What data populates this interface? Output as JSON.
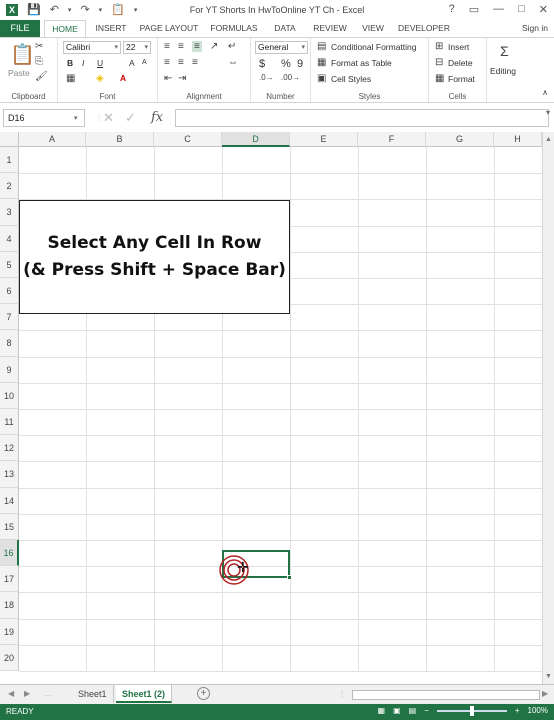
{
  "window": {
    "title": "For YT Shorts In HwToOnline YT Ch - Excel",
    "controls": [
      "?",
      "▭",
      "—",
      "□",
      "✕"
    ]
  },
  "tabs": {
    "file": "FILE",
    "items": [
      "HOME",
      "INSERT",
      "PAGE LAYOUT",
      "FORMULAS",
      "DATA",
      "REVIEW",
      "VIEW",
      "DEVELOPER"
    ],
    "active": "HOME",
    "signin": "Sign in"
  },
  "ribbon": {
    "clipboard": {
      "label": "Clipboard",
      "paste": "Paste"
    },
    "font": {
      "label": "Font",
      "name": "Calibri",
      "size": "22",
      "bold": "B",
      "italic": "I",
      "underline": "U",
      "grow": "A",
      "shrink": "A"
    },
    "alignment": {
      "label": "Alignment"
    },
    "number": {
      "label": "Number",
      "format": "General",
      "currency": "$",
      "percent": "%",
      "comma": "9"
    },
    "styles": {
      "label": "Styles",
      "conditional": "Conditional Formatting",
      "table": "Format as Table",
      "cell_styles": "Cell Styles"
    },
    "cells": {
      "label": "Cells",
      "insert": "Insert",
      "delete": "Delete",
      "format": "Format"
    },
    "editing": {
      "label": "Editing"
    }
  },
  "formula_bar": {
    "name_box": "D16",
    "fx": "fx",
    "value": ""
  },
  "grid": {
    "columns": [
      "A",
      "B",
      "C",
      "D",
      "E",
      "F",
      "G",
      "H"
    ],
    "rows": [
      "1",
      "2",
      "3",
      "4",
      "5",
      "6",
      "7",
      "8",
      "9",
      "10",
      "11",
      "12",
      "13",
      "14",
      "15",
      "16",
      "17",
      "18",
      "19",
      "20"
    ],
    "selected_col": "D",
    "selected_row": "16"
  },
  "textbox": {
    "line1": "Select Any Cell In Row",
    "line2": "(& Press Shift + Space Bar)"
  },
  "sheets": {
    "tabs": [
      "Sheet1",
      "Sheet1 (2)"
    ],
    "active": "Sheet1 (2)",
    "add": "+"
  },
  "status": {
    "ready": "READY",
    "zoom": "100%",
    "minus": "−",
    "plus": "+"
  },
  "colors": {
    "accent": "#217346"
  }
}
